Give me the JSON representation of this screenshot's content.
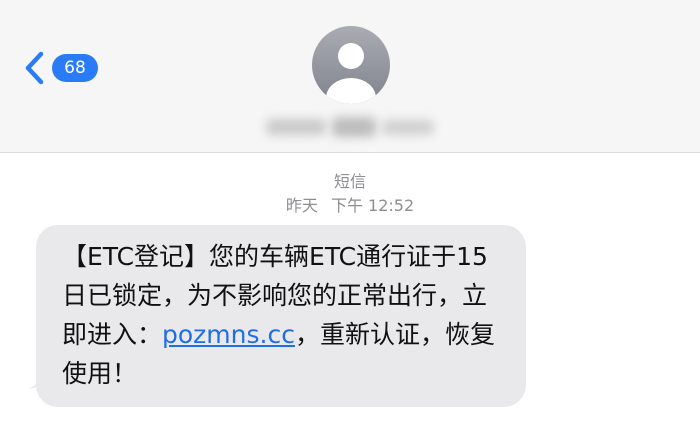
{
  "header": {
    "back_badge_count": "68",
    "contact_name": ""
  },
  "conversation": {
    "type_label": "短信",
    "timestamp_day": "昨天",
    "timestamp_period": "下午",
    "timestamp_time": "12:52"
  },
  "message": {
    "text_before_link": "【ETC登记】您的车辆ETC通行证于15日已锁定，为不影响您的正常出行，立即进入：",
    "link": "pozmns.cc",
    "text_after_link": "，重新认证，恢复使用！"
  },
  "colors": {
    "accent": "#2a7cf6",
    "bubble": "#e9e9eb",
    "header_bg": "#f6f6f6",
    "meta_text": "#8e8e93"
  },
  "icons": {
    "back": "chevron-left-icon",
    "avatar": "person-placeholder-icon"
  }
}
